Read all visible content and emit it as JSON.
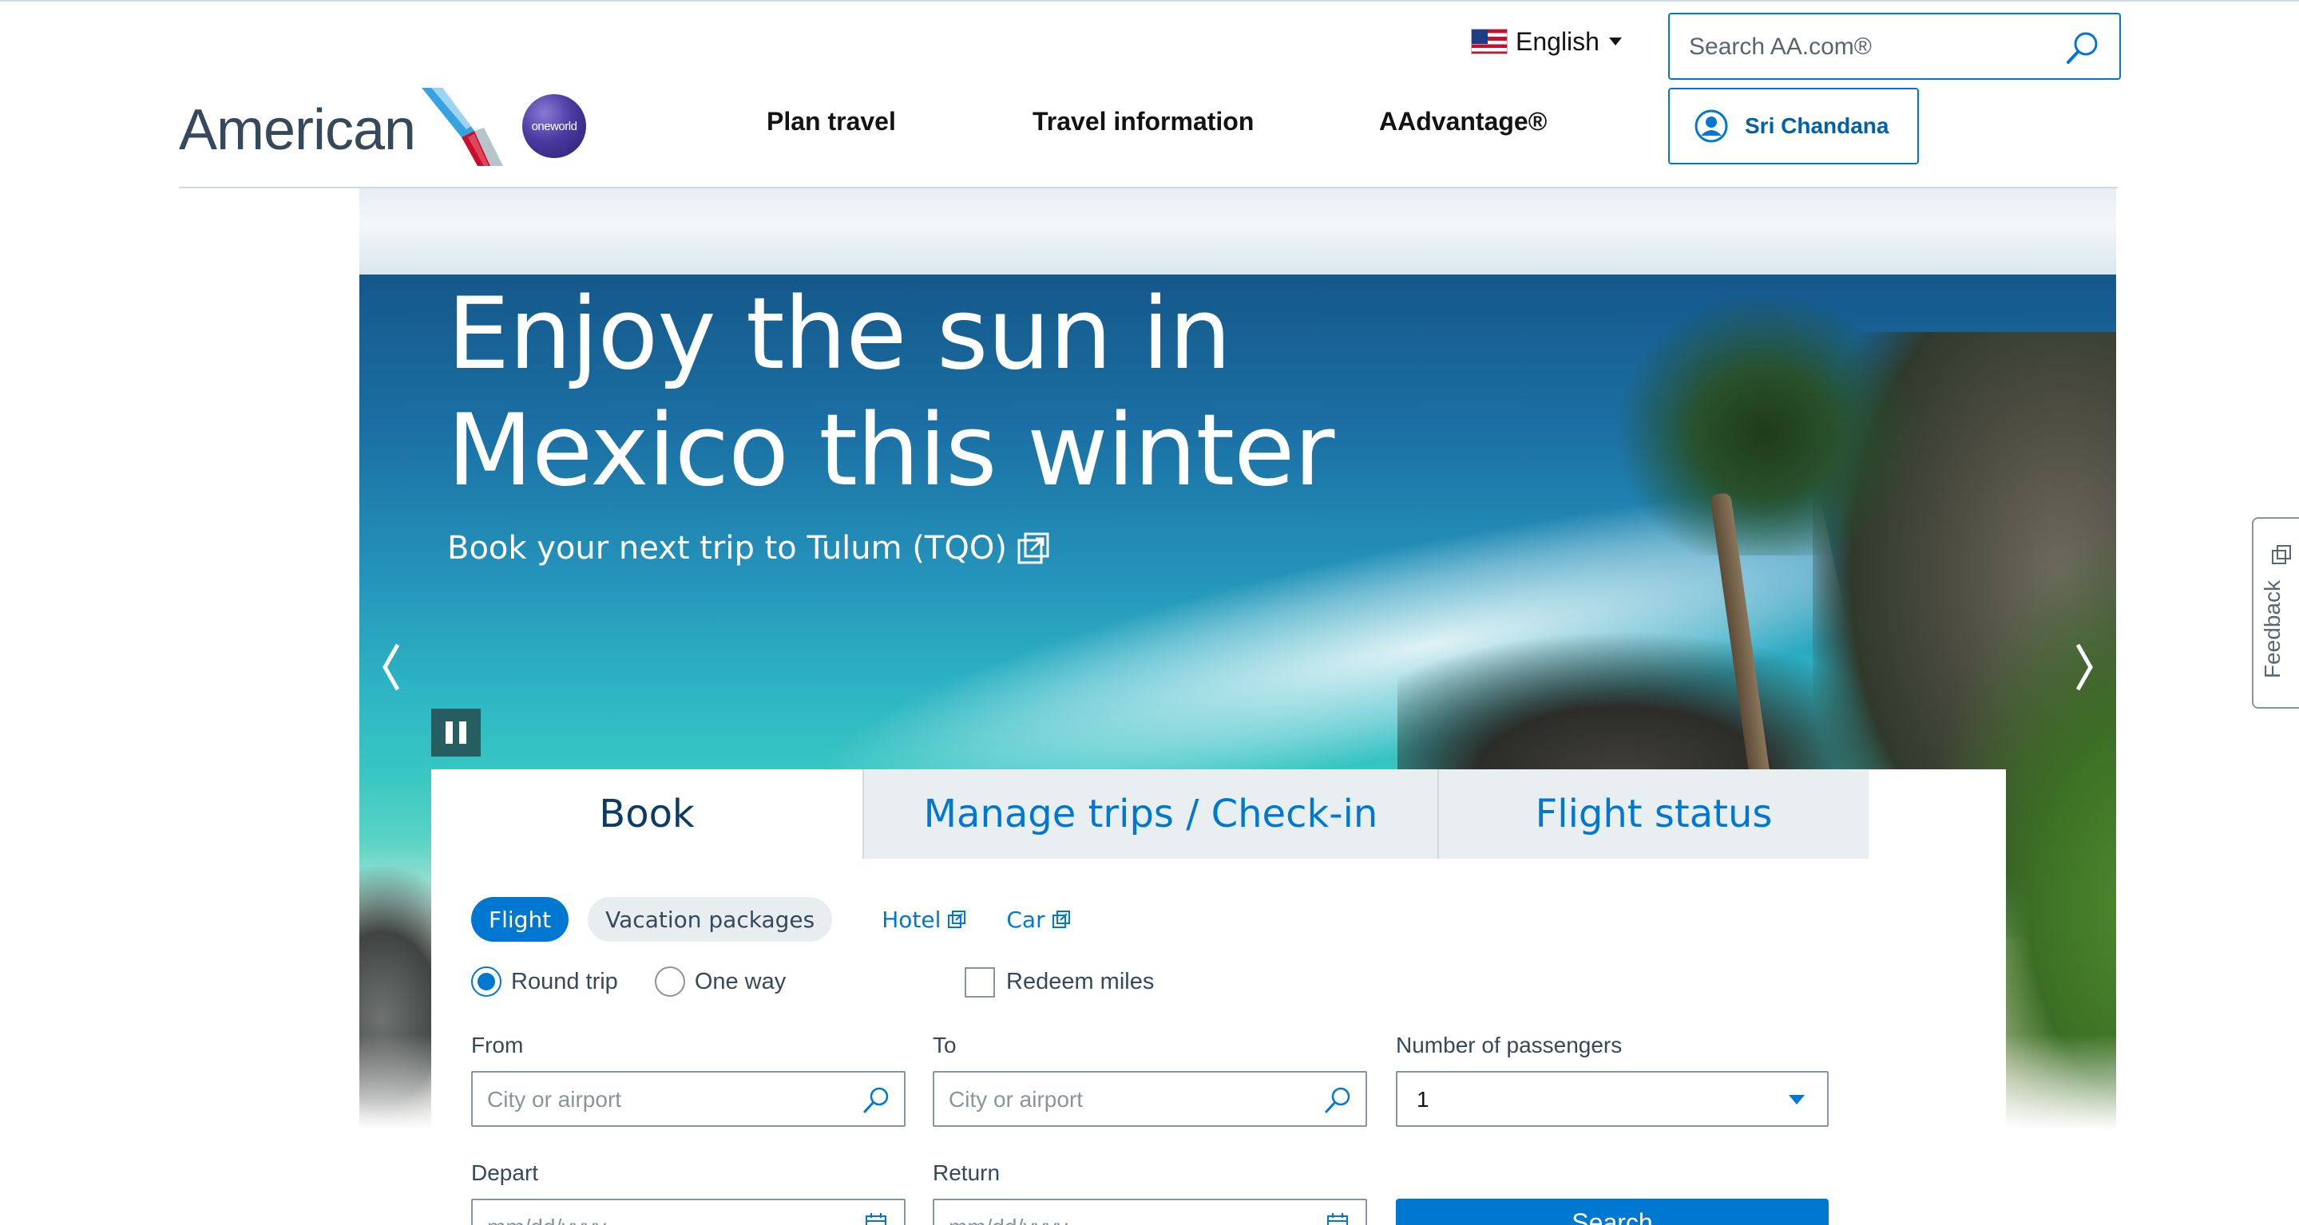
{
  "header": {
    "logo_text": "American",
    "oneworld_text": "oneworld",
    "nav": {
      "plan_travel": "Plan travel",
      "travel_information": "Travel information",
      "aadvantage": "AAdvantage®"
    },
    "language": "English",
    "search": {
      "placeholder": "Search AA.com®"
    },
    "user_name": "Sri Chandana"
  },
  "hero": {
    "title": "Enjoy the sun in\nMexico this winter",
    "subtitle": "Book your next trip to Tulum (TQO)"
  },
  "booking": {
    "tabs": [
      "Book",
      "Manage trips / Check-in",
      "Flight status"
    ],
    "chips": {
      "flight": "Flight",
      "vacation": "Vacation packages"
    },
    "links": {
      "hotel": "Hotel",
      "car": "Car"
    },
    "trip_type": {
      "round_trip": "Round trip",
      "one_way": "One way",
      "selected": "Round trip"
    },
    "redeem_miles": "Redeem miles",
    "from": {
      "label": "From",
      "placeholder": "City or airport"
    },
    "to": {
      "label": "To",
      "placeholder": "City or airport"
    },
    "passengers": {
      "label": "Number of passengers",
      "value": "1"
    },
    "depart": {
      "label": "Depart",
      "placeholder": "mm/dd/yyyy"
    },
    "return": {
      "label": "Return",
      "placeholder": "mm/dd/yyyy"
    },
    "search_button": "Search"
  },
  "feedback_label": "Feedback",
  "colors": {
    "brand_blue": "#0078d2",
    "text_dark": "#36495a",
    "tab_inactive_bg": "#e9eef1"
  }
}
